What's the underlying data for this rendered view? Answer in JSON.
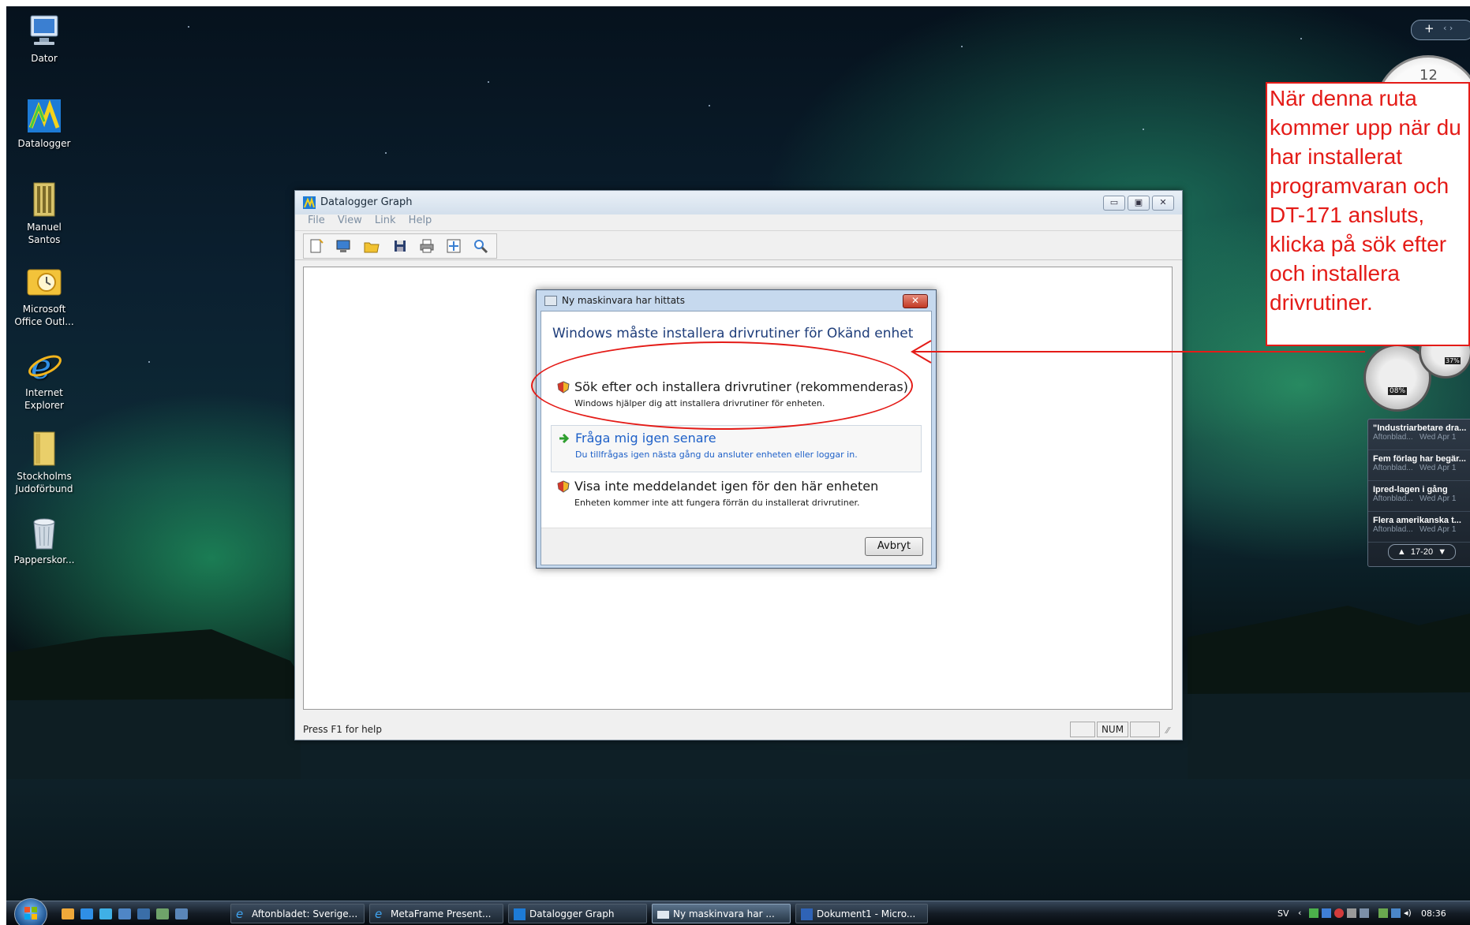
{
  "desktop": {
    "icons": [
      {
        "label": "Dator",
        "icon": "computer-icon"
      },
      {
        "label": "Datalogger",
        "icon": "datalogger-icon"
      },
      {
        "label": "Manuel Santos",
        "icon": "user-folder-icon"
      },
      {
        "label": "Microsoft Office Outl...",
        "icon": "outlook-icon"
      },
      {
        "label": "Internet Explorer",
        "icon": "internet-explorer-icon"
      },
      {
        "label": "Stockholms Judoförbund",
        "icon": "folder-icon"
      },
      {
        "label": "Papperskor...",
        "icon": "recycle-bin-icon"
      }
    ]
  },
  "app_window": {
    "title": "Datalogger Graph",
    "menu": [
      "File",
      "View",
      "Link",
      "Help"
    ],
    "toolbar": [
      "new-icon",
      "monitor-icon",
      "open-folder-icon",
      "save-icon",
      "print-icon",
      "fit-icon",
      "zoom-icon"
    ],
    "status_text": "Press F1 for help",
    "status_num": "NUM",
    "colors": {
      "title_bg": "#d3dfec",
      "client_bg": "#ffffff"
    }
  },
  "dialog": {
    "title": "Ny maskinvara har hittats",
    "heading": "Windows måste installera drivrutiner för Okänd enhet",
    "options": [
      {
        "title": "Sök efter och installera drivrutiner (rekommenderas)",
        "desc": "Windows hjälper dig att installera drivrutiner för enheten.",
        "icon": "shield-icon"
      },
      {
        "title": "Fråga mig igen senare",
        "desc": "Du tillfrågas igen nästa gång du ansluter enheten eller loggar in.",
        "icon": "green-arrow-icon"
      },
      {
        "title": "Visa inte meddelandet igen för den här enheten",
        "desc": "Enheten kommer inte att fungera förrän du installerat drivrutiner.",
        "icon": "shield-icon"
      }
    ],
    "cancel": "Avbryt"
  },
  "annotation": {
    "lines": [
      "När denna ruta",
      "kommer upp när du",
      "har installerat",
      "programvaran och",
      "DT-171 ansluts,",
      "klicka på sök efter",
      "och installera",
      "drivrutiner."
    ],
    "color": "#e41b17"
  },
  "gadgets": {
    "clock_number": "12",
    "meter_left": "08%",
    "meter_right": "37%",
    "feed": [
      {
        "headline": "\"Industriarbetare dra...",
        "source": "Aftonblad...",
        "date": "Wed Apr 1"
      },
      {
        "headline": "Fem förlag har begär...",
        "source": "Aftonblad...",
        "date": "Wed Apr 1"
      },
      {
        "headline": "Ipred-lagen i gång",
        "source": "Aftonblad...",
        "date": "Wed Apr 1"
      },
      {
        "headline": "Flera amerikanska t...",
        "source": "Aftonblad...",
        "date": "Wed Apr 1"
      }
    ],
    "pager": "17-20",
    "add_button": "+"
  },
  "taskbar": {
    "tasks": [
      {
        "label": "Aftonbladet: Sverige...",
        "icon": "internet-explorer-icon"
      },
      {
        "label": "MetaFrame Present...",
        "icon": "internet-explorer-icon"
      },
      {
        "label": "Datalogger Graph",
        "icon": "datalogger-icon"
      },
      {
        "label": "Ny maskinvara har ...",
        "icon": "hardware-icon"
      },
      {
        "label": "Dokument1 - Micro...",
        "icon": "word-icon"
      }
    ],
    "language": "SV",
    "clock": "08:36"
  }
}
